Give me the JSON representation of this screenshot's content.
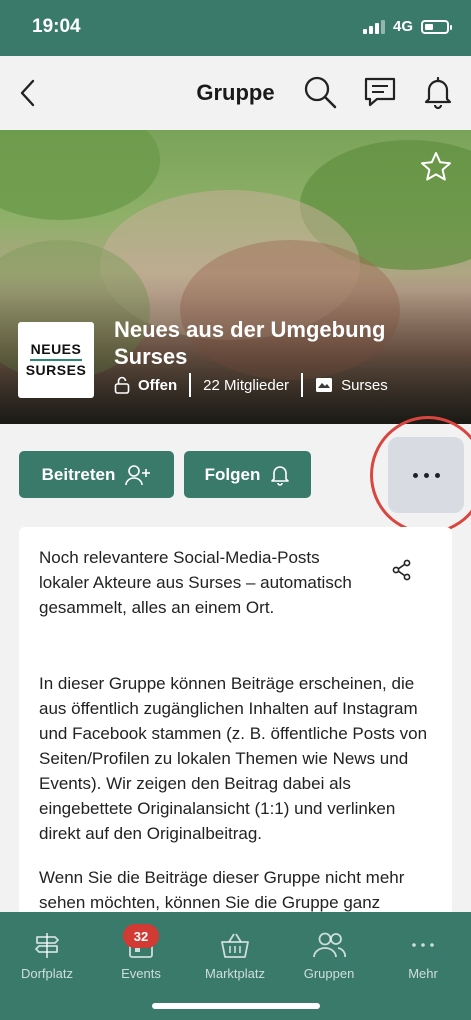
{
  "status_bar": {
    "time": "19:04",
    "network": "4G"
  },
  "header": {
    "title": "Gruppe"
  },
  "group": {
    "logo_line1": "NEUES",
    "logo_line2": "SURSES",
    "name": "Neues aus der Umgebung Surses",
    "privacy": "Offen",
    "members": "22 Mitglieder",
    "location": "Surses"
  },
  "actions": {
    "join_label": "Beitreten",
    "follow_label": "Folgen"
  },
  "description": {
    "p1": "Noch relevantere Social-Media-Posts lokaler Akteure aus Surses – automatisch gesammelt, alles an einem Ort.",
    "p2": "In dieser Gruppe können Beiträge erscheinen, die aus öffentlich zugänglichen Inhalten auf Instagram und Facebook stammen (z. B. öffentliche Posts von Seiten/Profilen zu lokalen Themen wie News und Events). Wir zeigen den Beitrag dabei als eingebettete Originalansicht (1:1) und verlinken direkt auf den Originalbeitrag.",
    "p3": "Wenn Sie die Beiträge dieser Gruppe nicht mehr sehen möchten, können Sie die Gruppe ganz"
  },
  "tabs": [
    {
      "label": "Dorfplatz"
    },
    {
      "label": "Events",
      "badge": "32"
    },
    {
      "label": "Marktplatz"
    },
    {
      "label": "Gruppen"
    },
    {
      "label": "Mehr"
    }
  ],
  "colors": {
    "brand_green": "#3a7a6a",
    "badge_red": "#d23a34",
    "highlight_red": "#d9463f",
    "more_button_bg": "#d8dbe1"
  }
}
